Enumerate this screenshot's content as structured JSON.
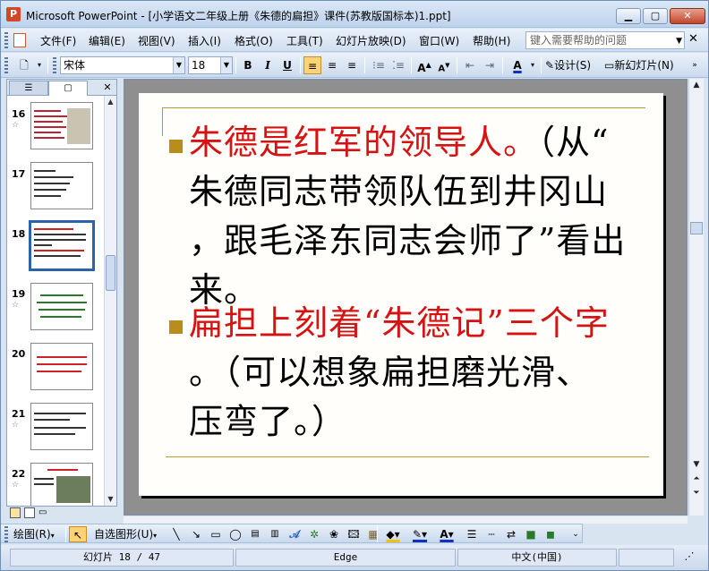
{
  "window": {
    "title": "Microsoft PowerPoint - [小学语文二年级上册《朱德的扁担》课件(苏教版国标本)1.ppt]",
    "app_icon_glyph": "P"
  },
  "menu": {
    "items": [
      "文件(F)",
      "编辑(E)",
      "视图(V)",
      "插入(I)",
      "格式(O)",
      "工具(T)",
      "幻灯片放映(D)",
      "窗口(W)",
      "帮助(H)"
    ],
    "help_placeholder": "键入需要帮助的问题"
  },
  "toolbar": {
    "font_name": "宋体",
    "font_size": "18",
    "bold": "B",
    "italic": "I",
    "underline": "U",
    "grow_font": "A",
    "shrink_font": "A",
    "font_color": "A",
    "design_label": "设计(S)",
    "new_slide_label": "新幻灯片(N)"
  },
  "thumbnails": {
    "items": [
      {
        "num": "16",
        "selected": false
      },
      {
        "num": "17",
        "selected": false
      },
      {
        "num": "18",
        "selected": true
      },
      {
        "num": "19",
        "selected": false
      },
      {
        "num": "20",
        "selected": false
      },
      {
        "num": "21",
        "selected": false
      },
      {
        "num": "22",
        "selected": false
      }
    ],
    "star": "☆"
  },
  "slide": {
    "p1_red": "朱德是红军的领导人。",
    "p1_l1_rest": "（从“",
    "p1_l2": "朱德同志带领队伍到井冈山",
    "p1_l3": "，跟毛泽东同志会师了”看出",
    "p1_l4": "来。",
    "p2_red": "扁担上刻着“朱德记”三个字",
    "p2_l2": "。（可以想象扁担磨光滑、",
    "p2_l3": "压弯了。）"
  },
  "drawbar": {
    "draw_label": "绘图(R)",
    "autoshape_label": "自选图形(U)"
  },
  "status": {
    "slide_count": "幻灯片 18 / 47",
    "design": "Edge",
    "language": "中文(中国)"
  },
  "colors": {
    "accent_red": "#d51313",
    "bullet_gold": "#b98d1c",
    "selection_blue": "#2b63a8"
  }
}
